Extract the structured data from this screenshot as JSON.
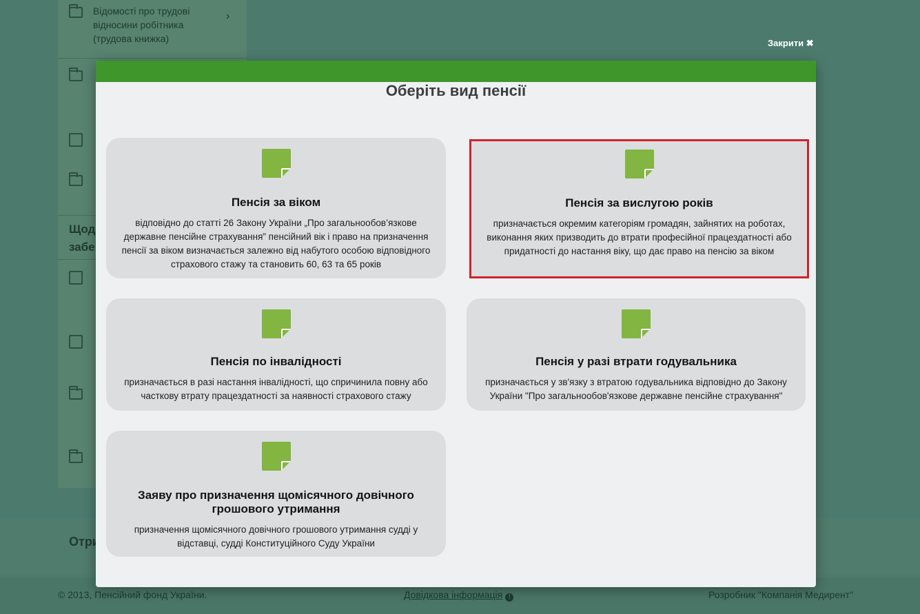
{
  "background": {
    "sidebar_items": [
      {
        "label": "Відомості про трудові відносини робітника (трудова книжка)"
      }
    ],
    "footer_label": "Отри",
    "heading": "Щод забе"
  },
  "footer": {
    "copyright": "© 2013, Пенсійний фонд України.",
    "help_link": "Довідкова інформація",
    "developer": "Розробник \"Компанія Медирент\""
  },
  "modal": {
    "close_label": "Закрити",
    "title": "Оберіть вид пенсії",
    "accent_color": "#3f962b",
    "icon_color": "#82b541",
    "selected_border_color": "#d0222a",
    "cards": [
      {
        "title": "Пенсія за віком",
        "description": "відповідно до статті 26 Закону України „Про загальнообов’язкове державне пенсійне страхування” пенсійний вік і право на призначення пенсії за віком визначається залежно від набутого особою відповідного страхового стажу та становить 60, 63 та 65 років",
        "icon": "document-icon"
      },
      {
        "title": "Пенсія за вислугою років",
        "description": "призначається окремим категоріям громадян, зайнятих на роботах, виконання яких призводить до втрати професійної працездатності або придатності до настання віку, що дає право на пенсію за віком",
        "icon": "document-icon",
        "selected": true
      },
      {
        "title": "Пенсія по інвалідності",
        "description": "призначається в разі настання інвалідності, що спричинила повну або часткову втрату працездатності за наявності страхового стажу",
        "icon": "document-icon"
      },
      {
        "title": "Пенсія у разі втрати годувальника",
        "description": "призначається у зв'язку з втратою годувальника відповідно до Закону України \"Про загальнообов'язкове державне пенсійне страхування\"",
        "icon": "document-icon"
      },
      {
        "title": "Заяву про призначення щомісячного довічного грошового утримання",
        "description": "призначення щомісячного довічного грошового утримання судді у відставці, судді Конституційного Суду України",
        "icon": "document-icon"
      }
    ]
  }
}
